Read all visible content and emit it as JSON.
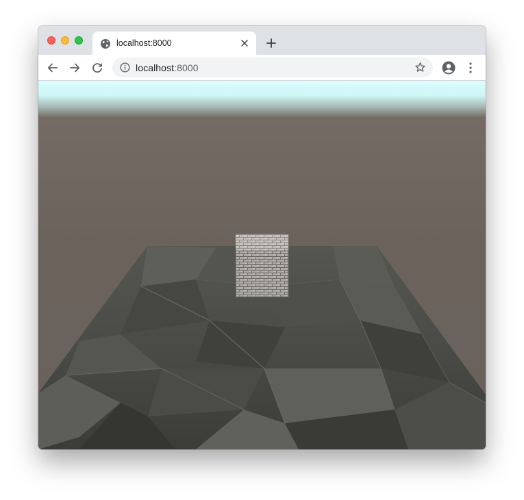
{
  "window": {
    "traffic_lights": {
      "close": "#fe5f57",
      "minimize": "#febc2e",
      "maximize": "#28c840"
    }
  },
  "tab": {
    "title": "localhost:8000",
    "favicon": "globe-icon",
    "close_icon": "close-icon"
  },
  "new_tab_icon": "plus-icon",
  "toolbar": {
    "back_icon": "arrow-left-icon",
    "forward_icon": "arrow-right-icon",
    "reload_icon": "reload-icon",
    "site_info_icon": "info-icon",
    "url_host": "localhost",
    "url_port": ":8000",
    "bookmark_icon": "star-icon",
    "profile_icon": "account-circle-icon",
    "menu_icon": "vertical-dots-icon"
  },
  "scene": {
    "sky_colors": [
      "#d9ffff",
      "#6b625c"
    ],
    "ground_color": "#4a4b46",
    "cube": "stone-brick cube"
  }
}
